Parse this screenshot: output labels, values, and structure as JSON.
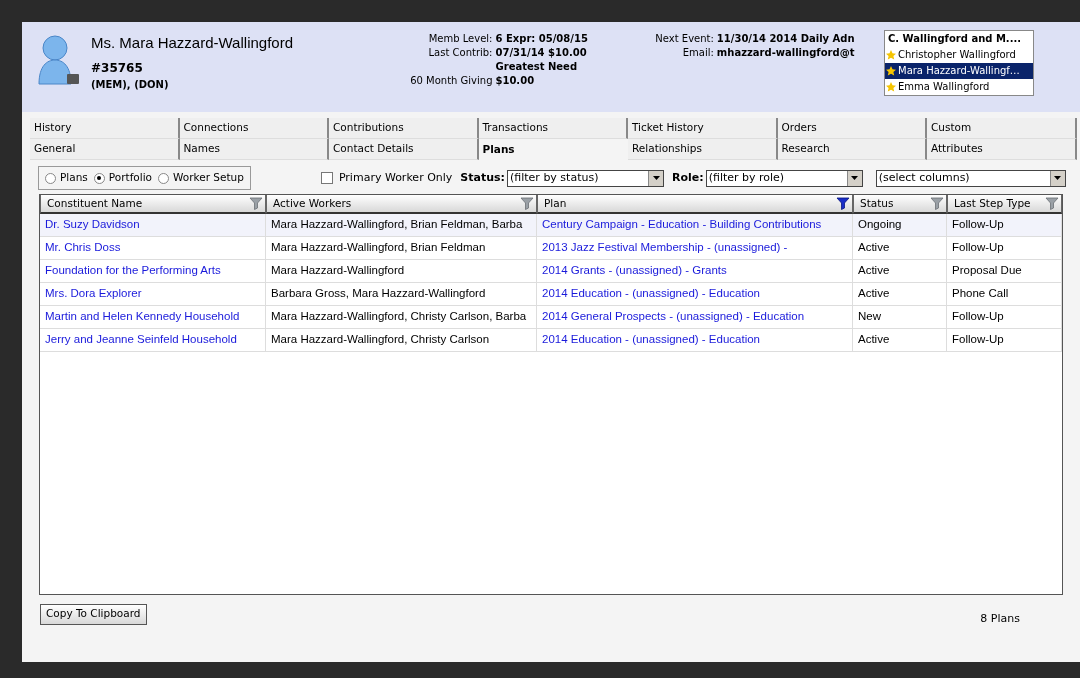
{
  "header": {
    "name": "Ms. Mara Hazzard-Wallingford",
    "id": "#35765",
    "codes": "(MEM), (DON)",
    "info": [
      {
        "label": "Memb Level:",
        "value": "6  Expr: 05/08/15"
      },
      {
        "label": "Last Contrib:",
        "value": "07/31/14 $10.00"
      },
      {
        "value": "Greatest Need"
      },
      {
        "label": "60 Month Giving",
        "value": "$10.00"
      }
    ],
    "events": [
      {
        "label": "Next Event:",
        "value": "11/30/14 2014 Daily Adn"
      },
      {
        "label": "Email:",
        "value": "mhazzard-wallingford@t"
      }
    ],
    "household": {
      "title": "C. Wallingford and M....",
      "members": [
        {
          "name": "Christopher Wallingford",
          "selected": false
        },
        {
          "name": "Mara Hazzard-Wallingf…",
          "selected": true
        },
        {
          "name": "Emma Wallingford",
          "selected": false
        }
      ]
    }
  },
  "tab_rows": [
    [
      {
        "label": "History",
        "selected": false
      },
      {
        "label": "Connections",
        "selected": false
      },
      {
        "label": "Contributions",
        "selected": false
      },
      {
        "label": "Transactions",
        "selected": false
      },
      {
        "label": "Ticket History",
        "selected": false
      },
      {
        "label": "Orders",
        "selected": false
      },
      {
        "label": "Custom",
        "selected": false
      }
    ],
    [
      {
        "label": "General",
        "selected": false
      },
      {
        "label": "Names",
        "selected": false
      },
      {
        "label": "Contact Details",
        "selected": false
      },
      {
        "label": "Plans",
        "selected": true
      },
      {
        "label": "Relationships",
        "selected": false
      },
      {
        "label": "Research",
        "selected": false
      },
      {
        "label": "Attributes",
        "selected": false
      }
    ]
  ],
  "view_options": [
    {
      "label": "Plans",
      "selected": false
    },
    {
      "label": "Portfolio",
      "selected": true
    },
    {
      "label": "Worker Setup",
      "selected": false
    }
  ],
  "primary_worker_only": {
    "label": "Primary Worker Only",
    "checked": false
  },
  "filters": [
    {
      "label": "Status:",
      "value": "(filter by status)"
    },
    {
      "label": "Role:",
      "value": "(filter by role)"
    },
    {
      "value": "(select columns)"
    }
  ],
  "table": {
    "columns": [
      {
        "label": "Constituent Name",
        "filtered": false
      },
      {
        "label": "Active Workers",
        "filtered": false
      },
      {
        "label": "Plan",
        "filtered": true
      },
      {
        "label": "Status",
        "filtered": false
      },
      {
        "label": "Last Step Type",
        "filtered": false
      }
    ],
    "rows": [
      {
        "selected": true,
        "cells": [
          "Dr. Suzy Davidson",
          "Mara Hazzard-Wallingford, Brian Feldman, Barba",
          "Century Campaign - Education - Building Contributions",
          "Ongoing",
          "Follow-Up"
        ]
      },
      {
        "selected": false,
        "cells": [
          "Mr. Chris Doss",
          "Mara Hazzard-Wallingford, Brian Feldman",
          "2013 Jazz Festival Membership - (unassigned) -",
          "Active",
          "Follow-Up"
        ]
      },
      {
        "selected": false,
        "cells": [
          "Foundation for the Performing Arts",
          "Mara Hazzard-Wallingford",
          "2014 Grants - (unassigned) - Grants",
          "Active",
          "Proposal Due"
        ]
      },
      {
        "selected": false,
        "cells": [
          "Mrs. Dora Explorer",
          "Barbara Gross, Mara Hazzard-Wallingford",
          "2014 Education - (unassigned) - Education",
          "Active",
          "Phone Call"
        ]
      },
      {
        "selected": false,
        "cells": [
          "Martin and Helen Kennedy Household",
          "Mara Hazzard-Wallingford, Christy Carlson, Barba",
          "2014 General Prospects - (unassigned) - Education",
          "New",
          "Follow-Up"
        ]
      },
      {
        "selected": false,
        "cells": [
          "Jerry and Jeanne Seinfeld Household",
          "Mara Hazzard-Wallingford, Christy Carlson",
          "2014 Education - (unassigned) - Education",
          "Active",
          "Follow-Up"
        ]
      }
    ]
  },
  "copy_button": "Copy To Clipboard",
  "count": "8 Plans"
}
